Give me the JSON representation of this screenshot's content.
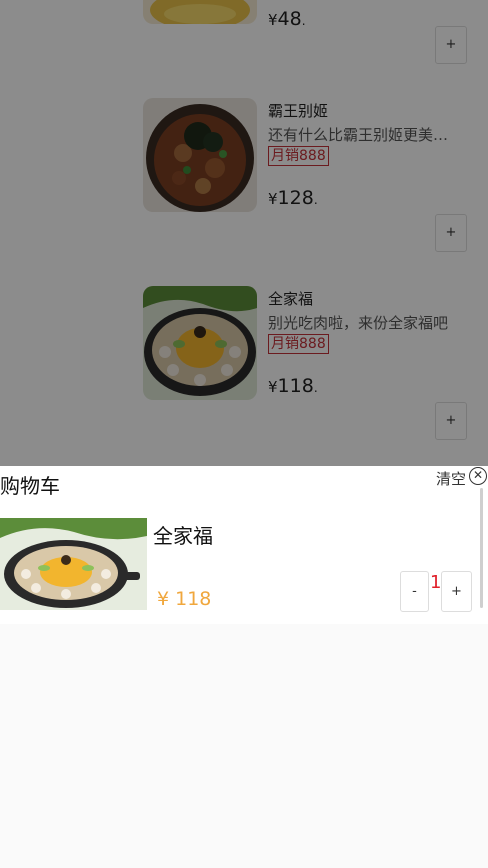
{
  "menu": {
    "items": [
      {
        "name": "",
        "desc": "",
        "tag": "",
        "price_symbol": "¥",
        "price": "48",
        "price_suffix": ".",
        "add_label": "+"
      },
      {
        "name": "霸王别姬",
        "desc": "还有什么比霸王别姬更美味的呢",
        "tag": "月销888",
        "price_symbol": "¥",
        "price": "128",
        "price_suffix": ".",
        "add_label": "+"
      },
      {
        "name": "全家福",
        "desc": "别光吃肉啦，来份全家福吧",
        "tag": "月销888",
        "price_symbol": "¥",
        "price": "118",
        "price_suffix": ".",
        "add_label": "+"
      }
    ]
  },
  "cart": {
    "title": "购物车",
    "clear_label": "清空",
    "close_glyph": "✕",
    "items": [
      {
        "name": "全家福",
        "price": "¥ 118",
        "minus_label": "-",
        "qty": "1",
        "plus_label": "+"
      }
    ]
  },
  "colors": {
    "accent_price": "#f0a73d",
    "qty_red": "#e0202a",
    "tag_red": "#c4323a"
  }
}
